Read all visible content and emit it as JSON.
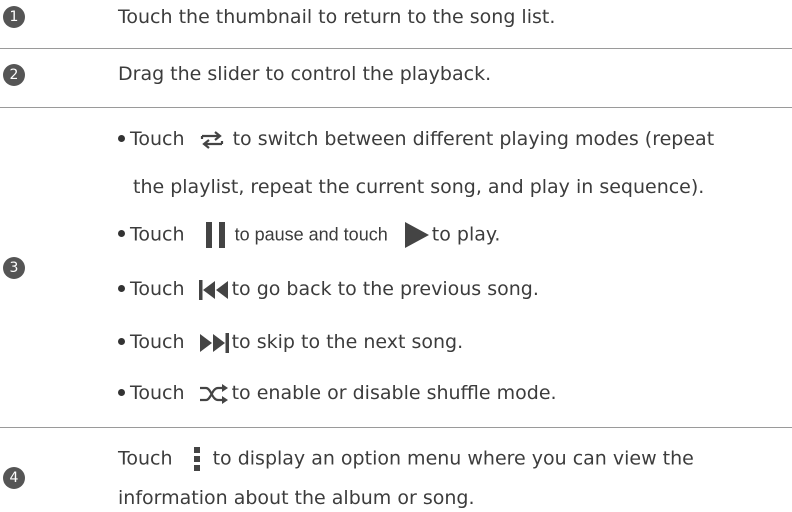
{
  "rows": [
    {
      "number": "1",
      "text": "Touch the thumbnail to return to the song list."
    },
    {
      "number": "2",
      "text": "Drag the slider to control the playback."
    },
    {
      "number": "3",
      "bullets": {
        "repeat": {
          "before": "Touch",
          "after_1": "to switch between different playing modes (repeat",
          "after_2": "the playlist, repeat the current song, and play in sequence)."
        },
        "pause_play": {
          "before": "Touch",
          "middle": "to pause and touch",
          "after": "to play."
        },
        "previous": {
          "before": "Touch",
          "after": "to go back to the previous song."
        },
        "next": {
          "before": "Touch",
          "after": "to skip to the next song."
        },
        "shuffle": {
          "before": "Touch",
          "after": "to enable or disable shuffle mode."
        }
      }
    },
    {
      "number": "4",
      "text_1_before": "Touch",
      "text_1_after": "to display an option menu where you can view the",
      "text_2": "information about the album or song."
    }
  ],
  "icons": {
    "repeat": "repeat-icon",
    "pause": "pause-icon",
    "play": "play-icon",
    "previous": "previous-track-icon",
    "next": "next-track-icon",
    "shuffle": "shuffle-icon",
    "menu": "menu-dots-icon"
  },
  "colors": {
    "badge": "#555555",
    "icon": "#444444",
    "separator": "#9a9a9a",
    "text": "#3c3c3c"
  }
}
